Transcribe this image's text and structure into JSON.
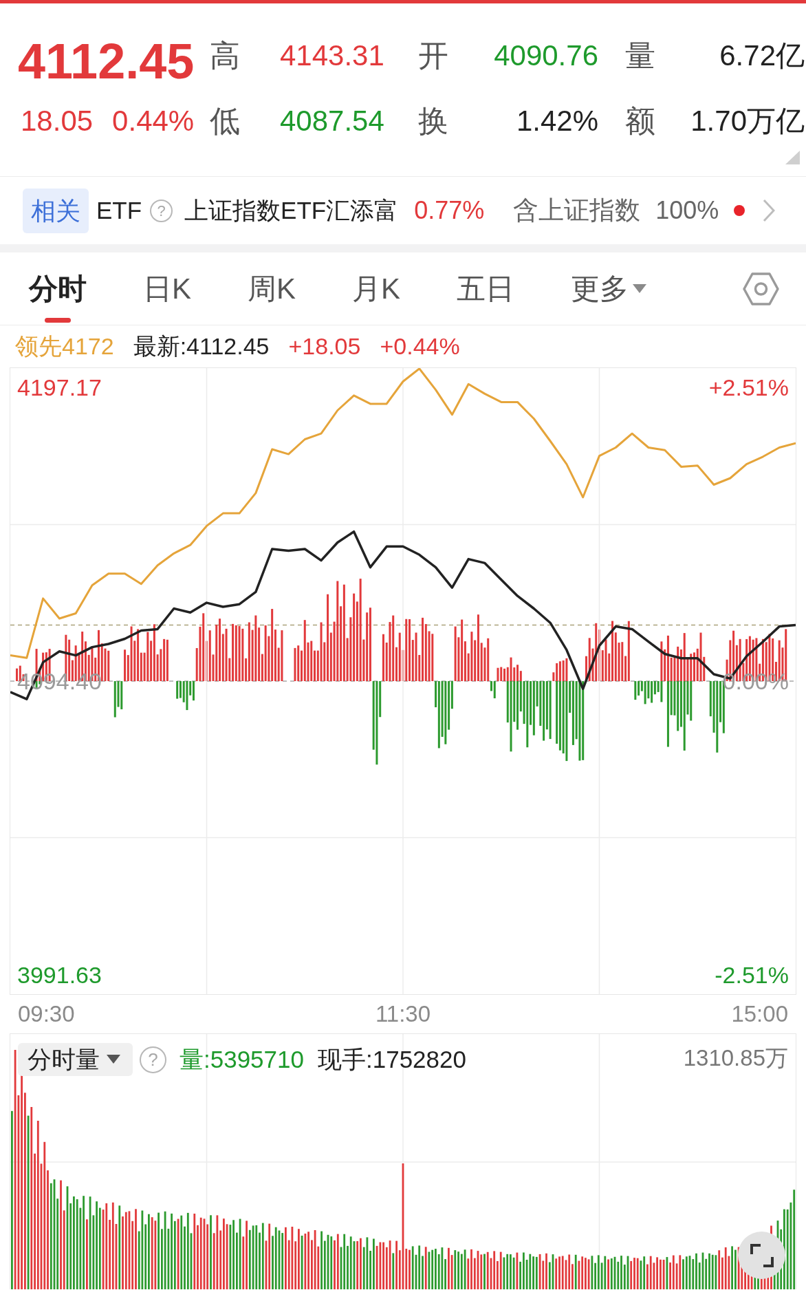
{
  "quote": {
    "price": "4112.45",
    "change": "18.05",
    "change_pct": "0.44%",
    "stats": [
      {
        "label": "高",
        "value": "4143.31",
        "color": "#e2393b"
      },
      {
        "label": "开",
        "value": "4090.76",
        "color": "#1e9a2c"
      },
      {
        "label": "量",
        "value": "6.72亿",
        "color": "#222222"
      },
      {
        "label": "低",
        "value": "4087.54",
        "color": "#1e9a2c"
      },
      {
        "label": "换",
        "value": "1.42%",
        "color": "#222222"
      },
      {
        "label": "额",
        "value": "1.70万亿",
        "color": "#222222"
      }
    ]
  },
  "related_etf": {
    "tag": "相关",
    "label": "ETF",
    "help": "?",
    "fund": "上证指数ETF汇添富",
    "change": "0.77%",
    "holding_label": "含上证指数",
    "holding": "100%",
    "indicator_dot": true
  },
  "tabs": [
    {
      "label": "分时",
      "selected": true,
      "dropdown": false
    },
    {
      "label": "日K",
      "selected": false,
      "dropdown": false
    },
    {
      "label": "周K",
      "selected": false,
      "dropdown": false
    },
    {
      "label": "月K",
      "selected": false,
      "dropdown": false
    },
    {
      "label": "五日",
      "selected": false,
      "dropdown": false
    },
    {
      "label": "更多",
      "selected": false,
      "dropdown": true
    }
  ],
  "intraday": {
    "leading": "领先4172",
    "latest": "最新:4112.45",
    "change": "+18.05",
    "change_pct": "+0.44%",
    "chart_data": {
      "type": "line",
      "series": [
        {
          "color": "#222222",
          "values": [
            4090.6,
            4088.1,
            4101.0,
            4104.8,
            4103.4,
            4106.3,
            4107.4,
            4109.2,
            4112.1,
            4112.6,
            4119.8,
            4118.4,
            4121.8,
            4120.4,
            4121.3,
            4125.6,
            4140.6,
            4140.0,
            4140.6,
            4136.6,
            4142.9,
            4146.7,
            4134.2,
            4141.5,
            4141.5,
            4138.6,
            4134.2,
            4127.1,
            4137.1,
            4135.7,
            4129.9,
            4124.2,
            4119.8,
            4114.8,
            4105.3,
            4091.7,
            4106.8,
            4113.5,
            4112.6,
            4108.2,
            4103.9,
            4102.4,
            4102.4,
            4096.8,
            4095.3,
            4103.1,
            4108.2,
            4113.5,
            4114.0
          ]
        },
        {
          "color": "#e5a43a",
          "values": [
            4103.4,
            4102.5,
            4123.3,
            4116.3,
            4118.1,
            4127.9,
            4132.0,
            4132.0,
            4128.4,
            4134.9,
            4139.1,
            4142.0,
            4148.7,
            4153.1,
            4153.1,
            4160.2,
            4175.5,
            4173.8,
            4179.0,
            4181.0,
            4189.1,
            4194.3,
            4191.4,
            4191.4,
            4199.2,
            4203.7,
            4196.3,
            4187.6,
            4198.3,
            4194.9,
            4192.0,
            4192.0,
            4186.2,
            4178.4,
            4170.3,
            4158.7,
            4173.2,
            4176.1,
            4181.0,
            4176.1,
            4175.2,
            4169.4,
            4169.8,
            4163.1,
            4165.4,
            4170.3,
            4172.9,
            4176.1,
            4177.6
          ]
        }
      ],
      "ylim": [
        3984.9,
        4203.9
      ],
      "yticks": [
        {
          "value": 4197.17,
          "label": "4197.17"
        },
        {
          "value": 4094.4,
          "label": "4094.40"
        },
        {
          "value": 3991.63,
          "label": "3991.63"
        }
      ],
      "grid": true
    },
    "percent_ticks": [
      "+2.51%",
      "0.00%",
      "-2.51%"
    ],
    "time_labels": [
      "09:30",
      "11:30",
      "15:00"
    ]
  },
  "volume_panel": {
    "selector": {
      "label": "分时量",
      "dropdown": true
    },
    "help": "?",
    "volume": "量:5395710",
    "last_volume": "现手:1752820",
    "max_label": "1310.85万"
  }
}
